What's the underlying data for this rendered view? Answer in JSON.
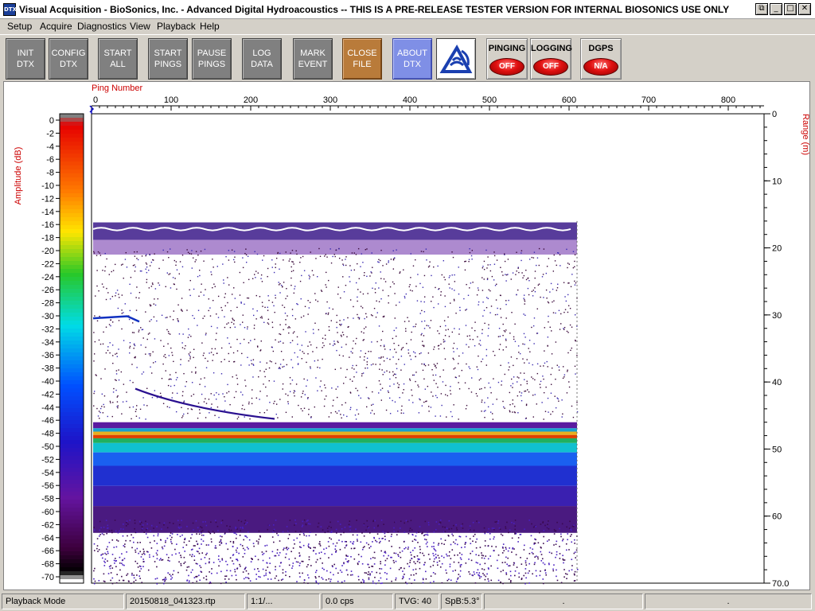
{
  "window": {
    "icon_text": "DTX",
    "title": "Visual Acquisition  -  BioSonics, Inc.  -  Advanced Digital Hydroacoustics  -- THIS IS A PRE-RELEASE TESTER VERSION FOR INTERNAL BIOSONICS USE ONLY",
    "buttons": {
      "restore": "⧉",
      "minimize": "_",
      "maximize": "□",
      "close": "✕"
    }
  },
  "menu": [
    "Setup",
    "Acquire",
    "Diagnostics",
    "View",
    "Playback",
    "Help"
  ],
  "toolbar": {
    "buttons": [
      {
        "label": "INIT\nDTX"
      },
      {
        "label": "CONFIG\nDTX"
      },
      {
        "label": "START\nALL"
      },
      {
        "label": "START\nPINGS"
      },
      {
        "label": "PAUSE\nPINGS"
      },
      {
        "label": "LOG\nDATA"
      },
      {
        "label": "MARK\nEVENT"
      },
      {
        "label": "CLOSE\nFILE"
      },
      {
        "label": "ABOUT\nDTX"
      }
    ],
    "indicators": [
      {
        "label": "PINGING",
        "state": "OFF"
      },
      {
        "label": "LOGGING",
        "state": "OFF"
      },
      {
        "label": "DGPS",
        "state": "N/A"
      }
    ],
    "colors": {
      "off_lamp": "#e01010",
      "close_button": "#b97b3a",
      "about_button": "#7f8fe6"
    }
  },
  "echogram": {
    "x_axis_label": "Ping Number",
    "x_ticks": [
      0,
      100,
      200,
      300,
      400,
      500,
      600,
      700,
      800
    ],
    "x_max": 845,
    "right_axis_label": "Range (m)",
    "range_ticks": [
      "0",
      "10",
      "20",
      "30",
      "40",
      "50",
      "60",
      "70.0"
    ],
    "range_max": 70,
    "pings_recorded": 610,
    "colorbar_label": "Amplitude (dB)",
    "colorbar_ticks": [
      0,
      -2,
      -4,
      -6,
      -8,
      -10,
      -12,
      -14,
      -16,
      -18,
      -20,
      -22,
      -24,
      -26,
      -28,
      -30,
      -32,
      -34,
      -36,
      -38,
      -40,
      -42,
      -44,
      -46,
      -48,
      -50,
      -52,
      -54,
      -56,
      -58,
      -60,
      -62,
      -64,
      -66,
      -68,
      -70
    ],
    "features": {
      "surface_band_m": 17,
      "bottom_m": 47.5
    }
  },
  "statusbar": {
    "mode": "Playback Mode",
    "file": "20150818_041323.rtp",
    "ratio": "1:1/...",
    "rate": "0.0 cps",
    "tvg": "TVG: 40",
    "spb": "SpB:5.3°",
    "p7": ".",
    "p8": "."
  }
}
